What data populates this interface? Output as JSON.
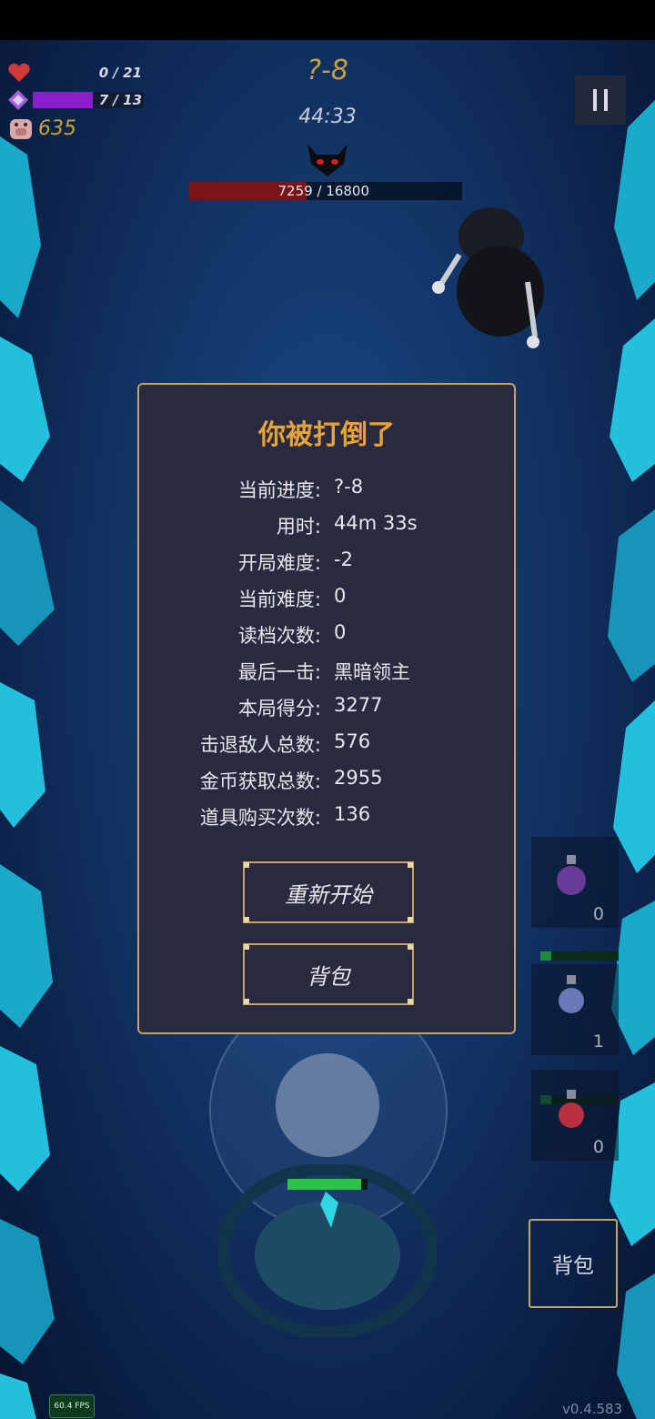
{
  "hud": {
    "health": {
      "text": "0 / 21",
      "fraction": 0
    },
    "mana": {
      "text": "7 / 13",
      "fraction": 0.54
    },
    "coins": "635",
    "stage": "?-8",
    "timer": "44:33",
    "boss_health": {
      "text": "7259 / 16800",
      "fraction": 0.43
    }
  },
  "dialog": {
    "title": "你被打倒了",
    "stats": [
      {
        "label": "当前进度:",
        "value": "?-8"
      },
      {
        "label": "用时:",
        "value": "44m 33s"
      },
      {
        "label": "开局难度:",
        "value": "-2"
      },
      {
        "label": "当前难度:",
        "value": "0"
      },
      {
        "label": "读档次数:",
        "value": "0"
      },
      {
        "label": "最后一击:",
        "value": "黑暗领主"
      },
      {
        "label": "本局得分:",
        "value": "3277"
      },
      {
        "label": "击退敌人总数:",
        "value": "576"
      },
      {
        "label": "金币获取总数:",
        "value": "2955"
      },
      {
        "label": "道具购买次数:",
        "value": "136"
      }
    ],
    "restart_label": "重新开始",
    "bag_label": "背包"
  },
  "items": [
    {
      "count": "0"
    },
    {
      "count": "1"
    },
    {
      "count": "0"
    }
  ],
  "bag_button": "背包",
  "fps": "60.4 FPS",
  "version": "v0.4.583",
  "colors": {
    "accent": "#c3a464",
    "title": "#e6a33a",
    "panel": "#292940",
    "mana": "#8a1ec8",
    "boss": "#7a1416"
  }
}
